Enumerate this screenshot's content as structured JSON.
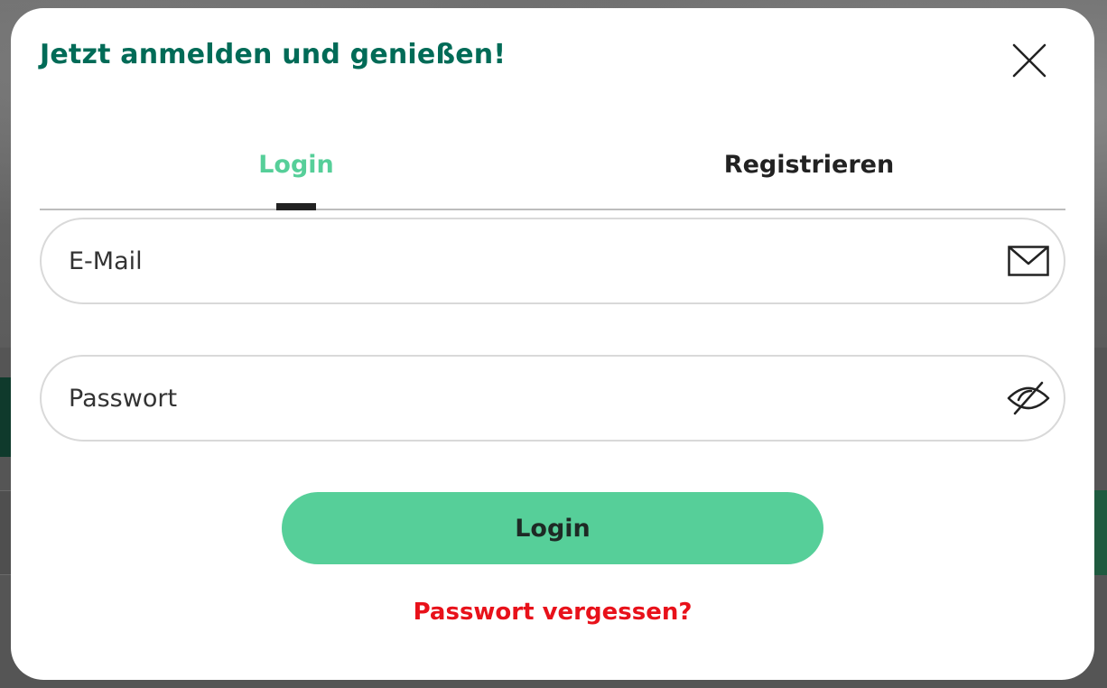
{
  "modal": {
    "title": "Jetzt anmelden und genießen!",
    "close_icon": "close-icon"
  },
  "tabs": [
    {
      "label": "Login",
      "active": true
    },
    {
      "label": "Registrieren",
      "active": false
    }
  ],
  "form": {
    "email": {
      "value": "",
      "placeholder": "E-Mail",
      "icon": "envelope-icon"
    },
    "password": {
      "value": "",
      "placeholder": "Passwort",
      "icon": "eye-off-icon"
    },
    "submit_label": "Login",
    "forgot_label": "Passwort vergessen?"
  },
  "colors": {
    "title": "#006b57",
    "accent": "#56cf99",
    "link": "#e8111a",
    "text": "#222222"
  }
}
